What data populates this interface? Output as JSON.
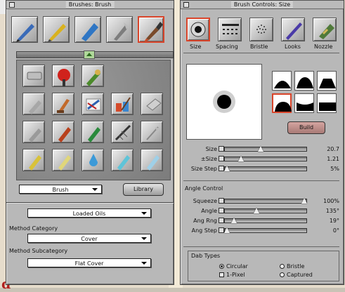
{
  "brushes_panel": {
    "title": "Brushes: Brush",
    "library_label": "Brush",
    "library_button": "Library",
    "brush_icons": [
      "pen",
      "pencil",
      "blue-marker",
      "cloner",
      "brush"
    ],
    "variant_icons": [
      "eraser",
      "airbrush-red",
      "liquid-brush",
      "chalk",
      "palette-knife",
      "smear",
      "paint-jars",
      "eraser-grey",
      "charcoal",
      "crayon",
      "felt-marker",
      "image-hose",
      "quill",
      "pencil-yellow",
      "chalk-yellow",
      "water-drop",
      "blue-stick",
      "light-stick"
    ]
  },
  "method": {
    "variant_value": "Loaded Oils",
    "category_label": "Method Category",
    "category_value": "Cover",
    "subcategory_label": "Method Subcategory",
    "subcategory_value": "Flat Cover"
  },
  "controls_panel": {
    "title": "Brush Controls: Size",
    "tabs": [
      "Size",
      "Spacing",
      "Bristle",
      "Looks",
      "Nozzle"
    ],
    "build_button": "Build",
    "sliders": [
      {
        "label": "Size",
        "value": "20.7",
        "level": 0.45
      },
      {
        "label": "±Size",
        "value": "1.21",
        "level": 0.2
      },
      {
        "label": "Size Step",
        "value": "5%",
        "level": 0.05
      }
    ],
    "angle_section": "Angle Control",
    "angle_sliders": [
      {
        "label": "Squeeze",
        "value": "100%",
        "level": 1.0
      },
      {
        "label": "Angle",
        "value": "135°",
        "level": 0.38
      },
      {
        "label": "Ang Rng",
        "value": "19°",
        "level": 0.1
      },
      {
        "label": "Ang Step",
        "value": "0°",
        "level": 0.0
      }
    ],
    "dab_types_label": "Dab Types",
    "dab_types": [
      {
        "label": "Circular",
        "selected": true
      },
      {
        "label": "Bristle",
        "selected": false
      },
      {
        "label": "1-Pixel",
        "selected": false
      },
      {
        "label": "Captured",
        "selected": false
      }
    ]
  }
}
